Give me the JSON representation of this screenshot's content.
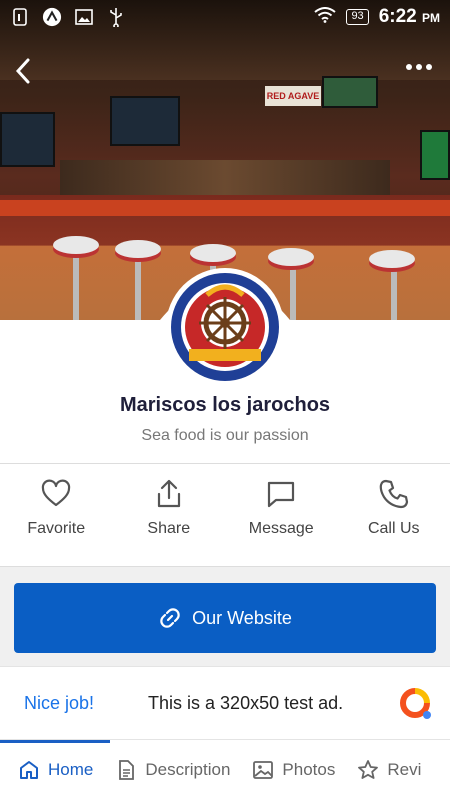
{
  "status_bar": {
    "time": "6:22",
    "ampm": "PM",
    "battery": "93"
  },
  "header": {
    "back_icon": "back-arrow-icon",
    "more_icon": "more-horizontal-icon"
  },
  "hero": {
    "sign_text": "RED AGAVE"
  },
  "restaurant": {
    "name": "Mariscos los jarochos",
    "tagline": "Sea food is our passion",
    "logo": {
      "top_text": "MARISCOS LOS JAROCHOS",
      "bottom_text": "MEXICAN RESTAURANT"
    }
  },
  "actions": [
    {
      "label": "Favorite",
      "icon": "heart-icon"
    },
    {
      "label": "Share",
      "icon": "share-icon"
    },
    {
      "label": "Message",
      "icon": "message-icon"
    },
    {
      "label": "Call Us",
      "icon": "phone-icon"
    }
  ],
  "website_button": {
    "label": "Our Website",
    "icon": "link-icon"
  },
  "ad": {
    "nice": "Nice job!",
    "text": "This is a 320x50 test ad."
  },
  "tabs": [
    {
      "label": "Home",
      "icon": "home-icon",
      "active": true
    },
    {
      "label": "Description",
      "icon": "document-icon"
    },
    {
      "label": "Photos",
      "icon": "image-icon"
    },
    {
      "label": "Revi",
      "icon": "star-icon"
    }
  ],
  "colors": {
    "primary": "#0a5ec4",
    "tab_active": "#1a5fc4",
    "nice": "#1a73e8"
  }
}
